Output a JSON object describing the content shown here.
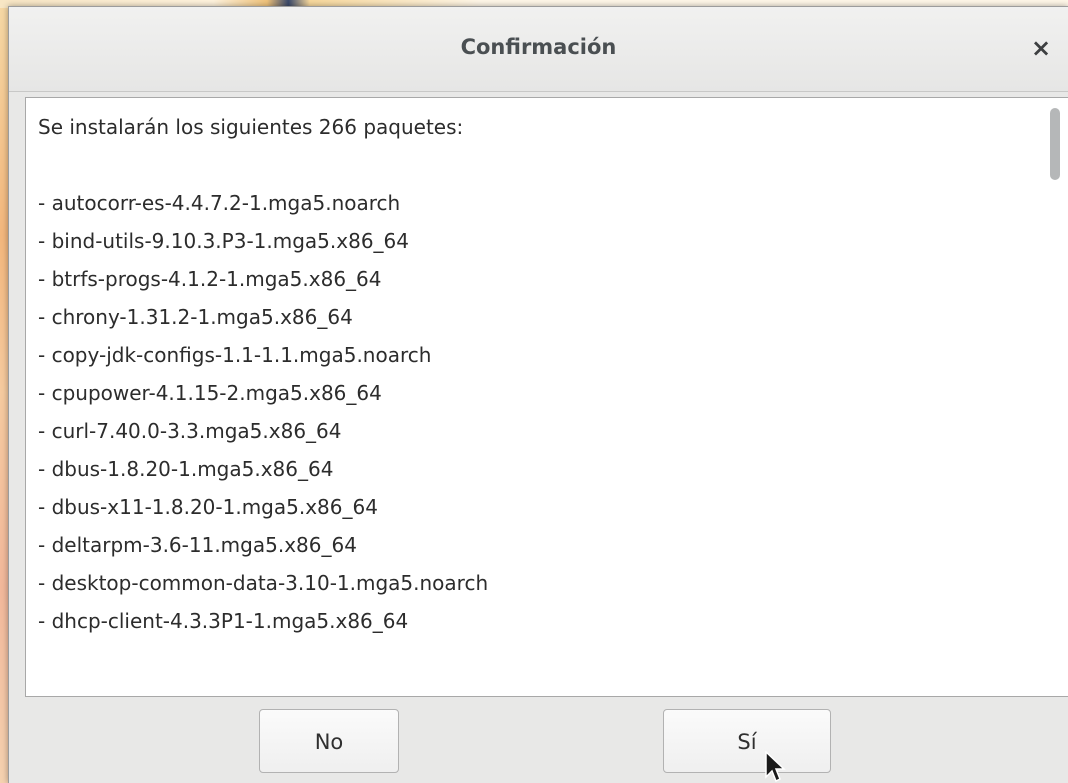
{
  "dialog": {
    "title": "Confirmación",
    "close_label": "×",
    "message_header": "Se instalarán los siguientes 266 paquetes:",
    "packages": [
      "- autocorr-es-4.4.7.2-1.mga5.noarch",
      "- bind-utils-9.10.3.P3-1.mga5.x86_64",
      "- btrfs-progs-4.1.2-1.mga5.x86_64",
      "- chrony-1.31.2-1.mga5.x86_64",
      "- copy-jdk-configs-1.1-1.1.mga5.noarch",
      "- cpupower-4.1.15-2.mga5.x86_64",
      "- curl-7.40.0-3.3.mga5.x86_64",
      "- dbus-1.8.20-1.mga5.x86_64",
      "- dbus-x11-1.8.20-1.mga5.x86_64",
      "- deltarpm-3.6-11.mga5.x86_64",
      "- desktop-common-data-3.10-1.mga5.noarch",
      "- dhcp-client-4.3.3P1-1.mga5.x86_64"
    ],
    "buttons": {
      "no_label": "No",
      "yes_label": "Sí"
    }
  },
  "icons": {
    "close": "close-icon",
    "cursor": "mouse-pointer-icon"
  },
  "colors": {
    "dialog_bg": "#e8e8e7",
    "title_text": "#4a4f52",
    "body_text": "#2c2c2c",
    "scroll_thumb": "#b5b7b8"
  }
}
